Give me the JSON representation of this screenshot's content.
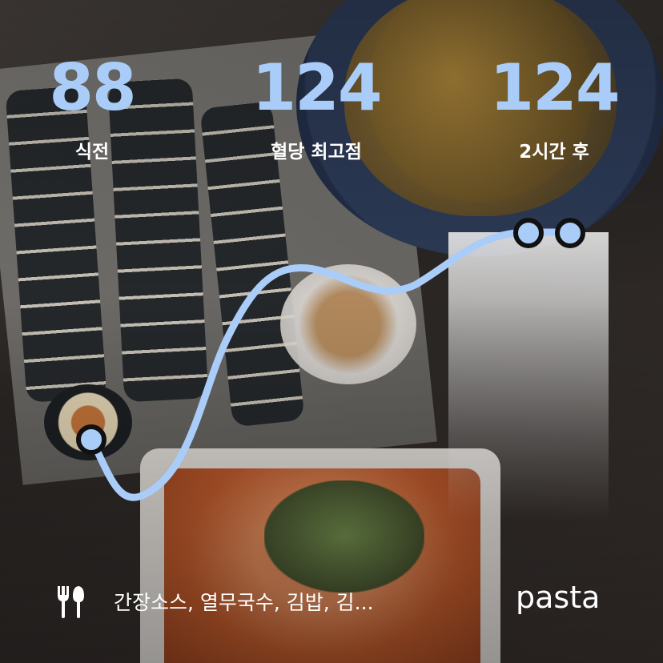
{
  "stats": {
    "before": {
      "value": "88",
      "label": "식전"
    },
    "peak": {
      "value": "124",
      "label": "혈당 최고점"
    },
    "after": {
      "value": "124",
      "label": "2시간 후"
    }
  },
  "meal": {
    "icon": "fork-knife-icon",
    "text": "간장소스, 열무국수, 김밥, 김..."
  },
  "brand": {
    "logo_text": "pasta"
  },
  "colors": {
    "accent": "#a9cdf8",
    "text": "#ffffff",
    "marker_fill": "#a9cdf8",
    "marker_stroke": "#111111"
  }
}
